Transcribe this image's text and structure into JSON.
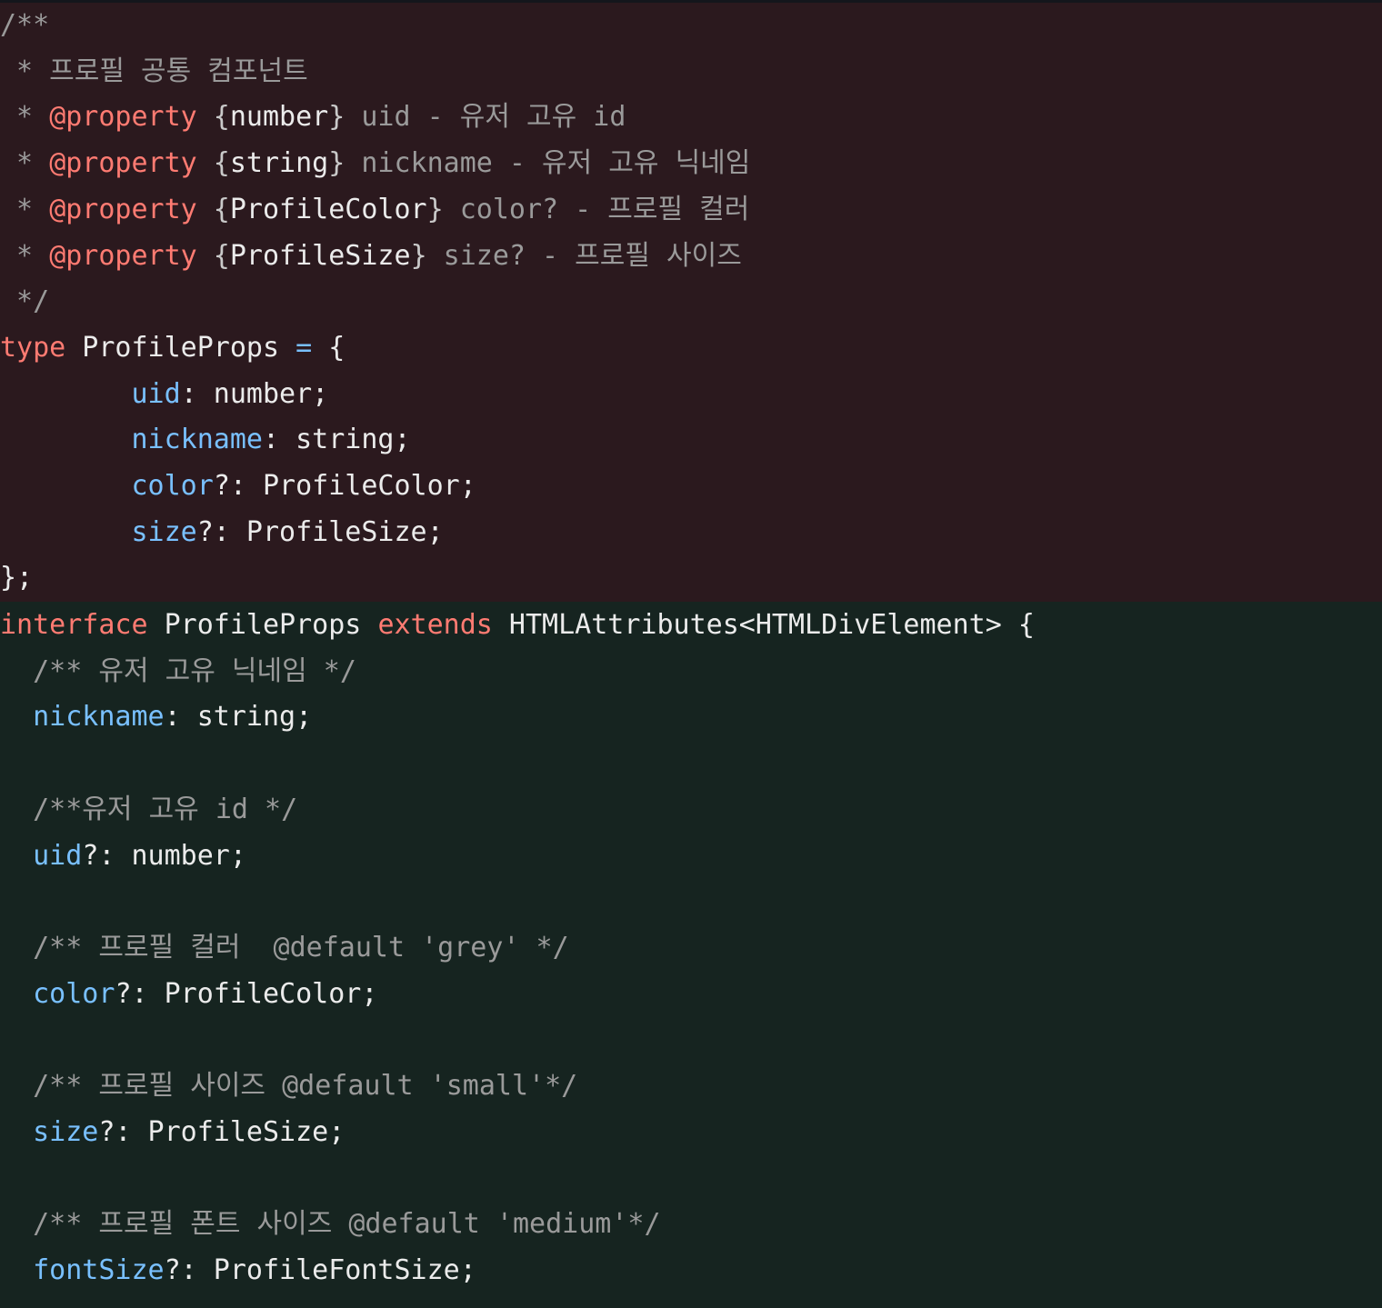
{
  "colors": {
    "removed_bg": "#2b191e",
    "added_bg": "#162420",
    "comment": "#9a9a9a",
    "keyword": "#ff7b72",
    "property": "#79c0ff",
    "text": "#ebebeb"
  },
  "old_block": {
    "lines": [
      [
        {
          "t": "/**",
          "c": "comment"
        }
      ],
      [
        {
          "t": " * 프로필 공통 컴포넌트",
          "c": "comment"
        }
      ],
      [
        {
          "t": " * ",
          "c": "comment"
        },
        {
          "t": "@property",
          "c": "tag"
        },
        {
          "t": " {",
          "c": "brace-doc"
        },
        {
          "t": "number",
          "c": "text"
        },
        {
          "t": "}",
          "c": "brace-doc"
        },
        {
          "t": " uid - 유저 고유 id",
          "c": "comment"
        }
      ],
      [
        {
          "t": " * ",
          "c": "comment"
        },
        {
          "t": "@property",
          "c": "tag"
        },
        {
          "t": " {",
          "c": "brace-doc"
        },
        {
          "t": "string",
          "c": "text"
        },
        {
          "t": "}",
          "c": "brace-doc"
        },
        {
          "t": " nickname - 유저 고유 닉네임",
          "c": "comment"
        }
      ],
      [
        {
          "t": " * ",
          "c": "comment"
        },
        {
          "t": "@property",
          "c": "tag"
        },
        {
          "t": " {",
          "c": "brace-doc"
        },
        {
          "t": "ProfileColor",
          "c": "text"
        },
        {
          "t": "}",
          "c": "brace-doc"
        },
        {
          "t": " color? - 프로필 컬러",
          "c": "comment"
        }
      ],
      [
        {
          "t": " * ",
          "c": "comment"
        },
        {
          "t": "@property",
          "c": "tag"
        },
        {
          "t": " {",
          "c": "brace-doc"
        },
        {
          "t": "ProfileSize",
          "c": "text"
        },
        {
          "t": "}",
          "c": "brace-doc"
        },
        {
          "t": " size? - 프로필 사이즈",
          "c": "comment"
        }
      ],
      [
        {
          "t": " */",
          "c": "comment"
        }
      ],
      [
        {
          "t": "type",
          "c": "keyword"
        },
        {
          "t": " ProfileProps ",
          "c": "text"
        },
        {
          "t": "=",
          "c": "op"
        },
        {
          "t": " {",
          "c": "text"
        }
      ],
      [
        {
          "t": "        ",
          "c": "text"
        },
        {
          "t": "uid",
          "c": "prop"
        },
        {
          "t": ": number;",
          "c": "text"
        }
      ],
      [
        {
          "t": "        ",
          "c": "text"
        },
        {
          "t": "nickname",
          "c": "prop"
        },
        {
          "t": ": string;",
          "c": "text"
        }
      ],
      [
        {
          "t": "        ",
          "c": "text"
        },
        {
          "t": "color",
          "c": "prop"
        },
        {
          "t": "?: ProfileColor;",
          "c": "text"
        }
      ],
      [
        {
          "t": "        ",
          "c": "text"
        },
        {
          "t": "size",
          "c": "prop"
        },
        {
          "t": "?: ProfileSize;",
          "c": "text"
        }
      ],
      [
        {
          "t": "};",
          "c": "text"
        }
      ]
    ]
  },
  "new_block": {
    "lines": [
      [
        {
          "t": "interface",
          "c": "keyword"
        },
        {
          "t": " ProfileProps ",
          "c": "text"
        },
        {
          "t": "extends",
          "c": "keyword"
        },
        {
          "t": " HTMLAttributes<HTMLDivElement> {",
          "c": "text"
        }
      ],
      [
        {
          "t": "  /** 유저 고유 닉네임 */",
          "c": "comment"
        }
      ],
      [
        {
          "t": "  ",
          "c": "text"
        },
        {
          "t": "nickname",
          "c": "prop"
        },
        {
          "t": ": string;",
          "c": "text"
        }
      ],
      [],
      [
        {
          "t": "  /**유저 고유 id */",
          "c": "comment"
        }
      ],
      [
        {
          "t": "  ",
          "c": "text"
        },
        {
          "t": "uid",
          "c": "prop"
        },
        {
          "t": "?: number;",
          "c": "text"
        }
      ],
      [],
      [
        {
          "t": "  /** 프로필 컬러  @default 'grey' */",
          "c": "comment"
        }
      ],
      [
        {
          "t": "  ",
          "c": "text"
        },
        {
          "t": "color",
          "c": "prop"
        },
        {
          "t": "?: ProfileColor;",
          "c": "text"
        }
      ],
      [],
      [
        {
          "t": "  /** 프로필 사이즈 @default 'small'*/",
          "c": "comment"
        }
      ],
      [
        {
          "t": "  ",
          "c": "text"
        },
        {
          "t": "size",
          "c": "prop"
        },
        {
          "t": "?: ProfileSize;",
          "c": "text"
        }
      ],
      [],
      [
        {
          "t": "  /** 프로필 폰트 사이즈 @default 'medium'*/",
          "c": "comment"
        }
      ],
      [
        {
          "t": "  ",
          "c": "text"
        },
        {
          "t": "fontSize",
          "c": "prop"
        },
        {
          "t": "?: ProfileFontSize;",
          "c": "text"
        }
      ]
    ]
  }
}
